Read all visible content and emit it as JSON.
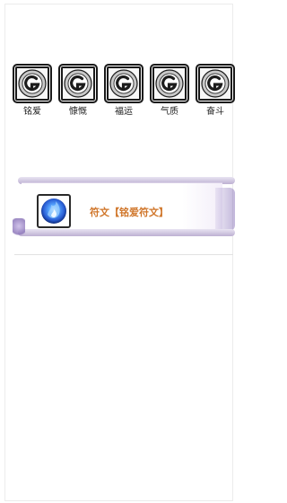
{
  "traits": [
    {
      "label": "铭爱",
      "icon": "swirl-icon"
    },
    {
      "label": "慷慨",
      "icon": "swirl-icon"
    },
    {
      "label": "福运",
      "icon": "swirl-icon"
    },
    {
      "label": "气质",
      "icon": "swirl-icon"
    },
    {
      "label": "奋斗",
      "icon": "swirl-icon"
    }
  ],
  "rune": {
    "title": "符文【铭爱符文】",
    "icon": "blue-flame-orb-icon"
  },
  "colors": {
    "accent": "#d0762a",
    "scroll": "#9b86c4",
    "orb": "#2a5fd6"
  }
}
